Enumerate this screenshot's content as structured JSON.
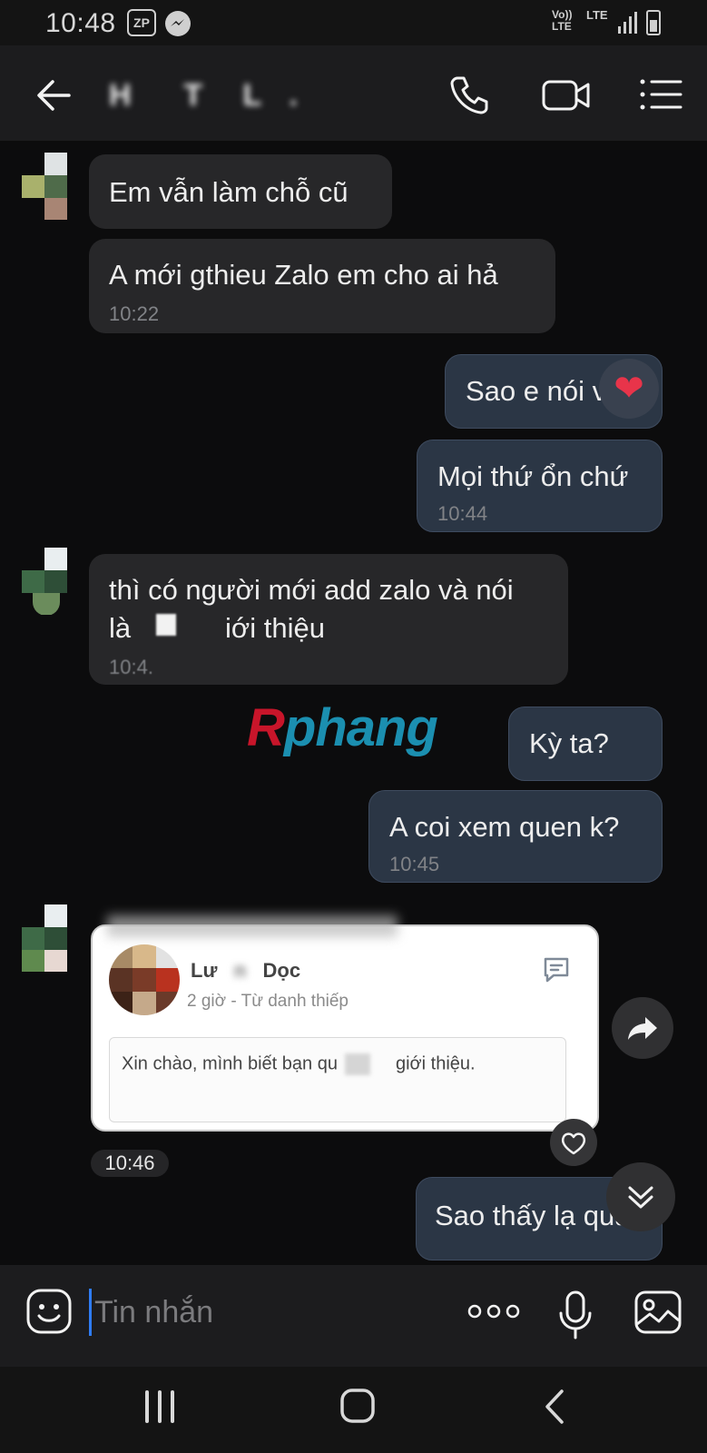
{
  "status_bar": {
    "time": "10:48",
    "app_badge": "ZP",
    "network_volte": "Vo))\nLTE",
    "network_lte": "LTE"
  },
  "header": {
    "contact_name": "H    T   L  ."
  },
  "messages": [
    {
      "side": "in",
      "text": "Em vẫn làm chỗ cũ",
      "time": ""
    },
    {
      "side": "in",
      "text": "A mới gthieu Zalo em cho ai hả",
      "time": "10:22"
    },
    {
      "side": "out",
      "text": "Sao e nói vậy",
      "time": "",
      "reaction": "heart"
    },
    {
      "side": "out",
      "text": "Mọi thứ ổn chứ",
      "time": "10:44"
    },
    {
      "side": "in",
      "line1": "thì có người mới add zalo và nói",
      "line2_start": "là",
      "line2_end": "iới thiệu",
      "time": "10:4."
    },
    {
      "side": "out",
      "text": "Kỳ ta?",
      "time": ""
    },
    {
      "side": "out",
      "text": "A coi xem quen k?",
      "time": "10:45"
    },
    {
      "side": "out",
      "text": "Sao thấy lạ qua",
      "time": ""
    }
  ],
  "watermark": {
    "part1": "R",
    "part2": "phang"
  },
  "shared_card": {
    "name_start": "Lư",
    "name_blur": "   n   ",
    "name_end": "Dọc",
    "subtitle": "2 giờ - Từ danh thiếp",
    "message_start": "Xin chào, mình biết bạn qu",
    "message_end": "giới thiệu.",
    "time": "10:46"
  },
  "input": {
    "placeholder": "Tin nhắn"
  },
  "colors": {
    "background": "#0c0c0d",
    "incoming_bubble": "#272729",
    "outgoing_bubble": "#2b3645",
    "caret": "#2f7cf6",
    "heart": "#e8344a"
  }
}
